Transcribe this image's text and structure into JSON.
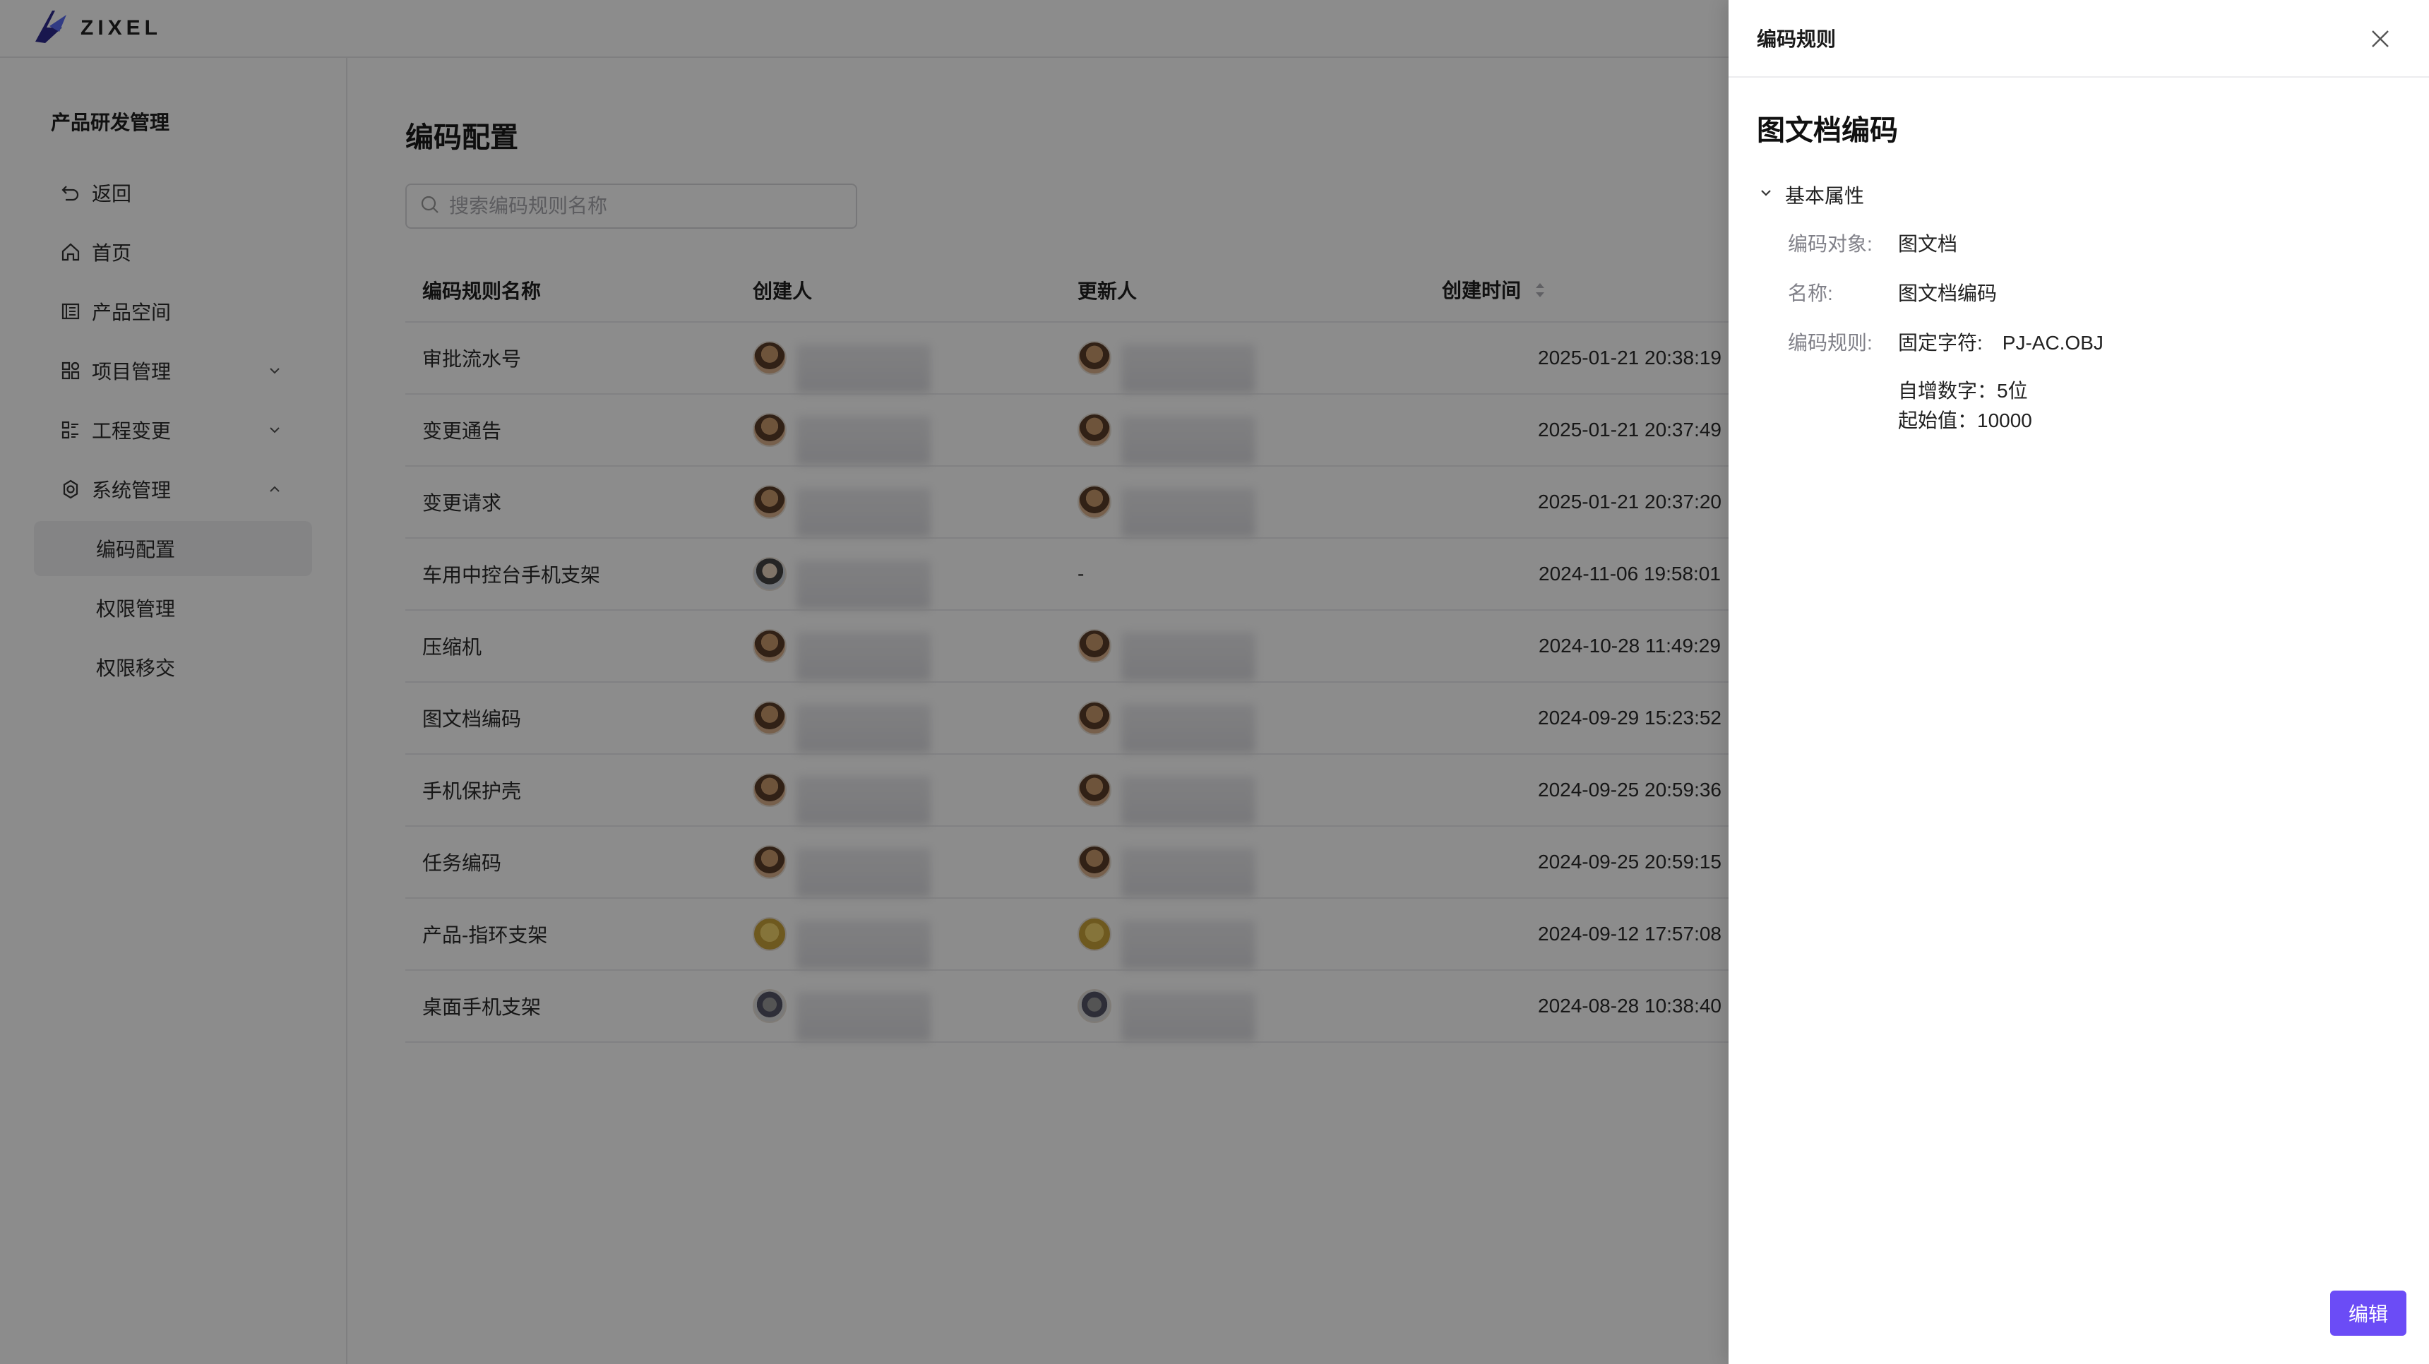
{
  "app": {
    "logo_text": "ZIXEL"
  },
  "sidebar": {
    "title": "产品研发管理",
    "items": [
      {
        "label": "返回",
        "icon": "undo-icon"
      },
      {
        "label": "首页",
        "icon": "home-icon"
      },
      {
        "label": "产品空间",
        "icon": "book-icon"
      },
      {
        "label": "项目管理",
        "icon": "grid-icon",
        "expand": "chevron-down-icon"
      },
      {
        "label": "工程变更",
        "icon": "list-icon",
        "expand": "chevron-down-icon"
      },
      {
        "label": "系统管理",
        "icon": "gear-icon",
        "expand": "chevron-up-icon"
      },
      {
        "label": "编码配置",
        "sub": true,
        "active": true
      },
      {
        "label": "权限管理",
        "sub": true
      },
      {
        "label": "权限移交",
        "sub": true
      }
    ]
  },
  "main": {
    "title": "编码配置",
    "search": {
      "placeholder": "搜索编码规则名称",
      "value": ""
    },
    "table": {
      "columns": [
        "编码规则名称",
        "创建人",
        "更新人",
        "创建时间"
      ],
      "rows": [
        {
          "name": "审批流水号",
          "updater": "",
          "time": "2025-01-21 20:38:19"
        },
        {
          "name": "变更通告",
          "updater": "",
          "time": "2025-01-21 20:37:49"
        },
        {
          "name": "变更请求",
          "updater": "",
          "time": "2025-01-21 20:37:20"
        },
        {
          "name": "车用中控台手机支架",
          "updater": "-",
          "time": "2024-11-06 19:58:01"
        },
        {
          "name": "压缩机",
          "updater": "",
          "time": "2024-10-28 11:49:29"
        },
        {
          "name": "图文档编码",
          "updater": "",
          "time": "2024-09-29 15:23:52"
        },
        {
          "name": "手机保护壳",
          "updater": "",
          "time": "2024-09-25 20:59:36"
        },
        {
          "name": "任务编码",
          "updater": "",
          "time": "2024-09-25 20:59:15"
        },
        {
          "name": "产品-指环支架",
          "updater": "",
          "time": "2024-09-12 17:57:08"
        },
        {
          "name": "桌面手机支架",
          "updater": "",
          "time": "2024-08-28 10:38:40"
        }
      ]
    }
  },
  "drawer": {
    "header_title": "编码规则",
    "record_title": "图文档编码",
    "section_title": "基本属性",
    "props": {
      "object_label": "编码对象:",
      "object_value": "图文档",
      "name_label": "名称:",
      "name_value": "图文档编码",
      "rule_label": "编码规则:",
      "fixed_label": "固定字符:",
      "fixed_value": "PJ-AC.OBJ",
      "increment_text": "自增数字：5位",
      "start_text": "起始值：10000"
    },
    "edit_label": "编辑"
  },
  "colors": {
    "accent": "#6b4cf6",
    "mask": "rgba(0,0,0,0.45)"
  }
}
